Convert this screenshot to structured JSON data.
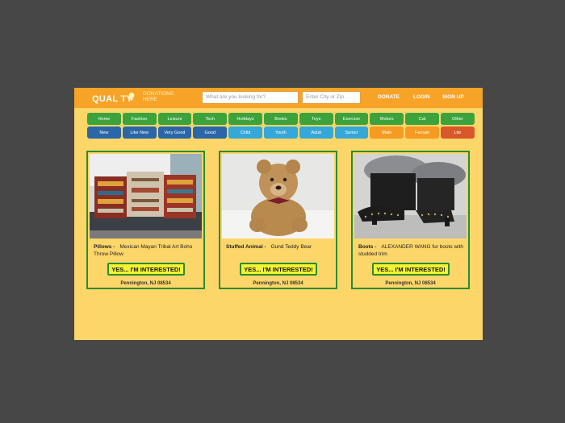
{
  "logo": {
    "main": "QUAL  TY",
    "sub_line1": "DONATIONS",
    "sub_line2": "HERE"
  },
  "search": {
    "query_placeholder": "What are you looking for?",
    "location_placeholder": "Enter City or Zip"
  },
  "nav": {
    "donate": "DONATE",
    "login": "LOGIN",
    "signup": "SIGN UP"
  },
  "categories": [
    "Home",
    "Fashion",
    "Leisure",
    "Tech",
    "Holidays",
    "Books",
    "Toys",
    "Exercise",
    "Motors",
    "Cat",
    "Other"
  ],
  "filters": [
    {
      "label": "New",
      "color": "#2b66a8"
    },
    {
      "label": "Like New",
      "color": "#2b66a8"
    },
    {
      "label": "Very Good",
      "color": "#2b66a8"
    },
    {
      "label": "Good",
      "color": "#2b66a8"
    },
    {
      "label": "Child",
      "color": "#35a8d9"
    },
    {
      "label": "Youth",
      "color": "#35a8d9"
    },
    {
      "label": "Adult",
      "color": "#35a8d9"
    },
    {
      "label": "Senior",
      "color": "#35a8d9"
    },
    {
      "label": "Male",
      "color": "#f59a22"
    },
    {
      "label": "Female",
      "color": "#f59a22"
    },
    {
      "label": "Lite",
      "color": "#d9582a"
    }
  ],
  "colors": {
    "category_green": "#3ca33c",
    "card_border": "#2e8b2e",
    "topbar": "#f7a327",
    "page": "#fdd66a"
  },
  "items": [
    {
      "category": "Pillows -",
      "title": "Mexican Mayan Tribal Art Boho Throw Pillow",
      "button": "YES... I'M INTERESTED!",
      "location": "Pennington, NJ 08534",
      "image": "pillows-photo"
    },
    {
      "category": "Stuffed Animal -",
      "title": "Gund Teddy Bear",
      "button": "YES... I'M INTERESTED!",
      "location": "Pennington, NJ 08534",
      "image": "teddy-bear-photo"
    },
    {
      "category": "Boots -",
      "title": "ALEXANDER WANG fur boots with studded trim",
      "button": "YES... I'M INTERESTED!",
      "location": "Pennington, NJ 08534",
      "image": "boots-photo"
    }
  ]
}
